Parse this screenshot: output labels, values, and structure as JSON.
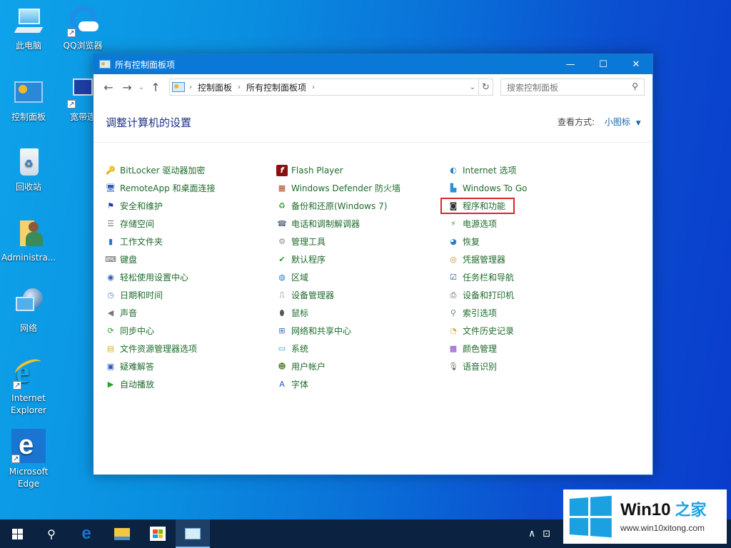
{
  "desktop": {
    "icons": [
      {
        "name": "this-pc",
        "label": "此电脑"
      },
      {
        "name": "qq-browser",
        "label": "QQ浏览器"
      },
      {
        "name": "control-panel",
        "label": "控制面板"
      },
      {
        "name": "broadband",
        "label": "宽带连"
      },
      {
        "name": "recycle-bin",
        "label": "回收站"
      },
      {
        "name": "administrator",
        "label": "Administra..."
      },
      {
        "name": "network",
        "label": "网络"
      },
      {
        "name": "internet-explorer",
        "label": "Internet Explorer"
      },
      {
        "name": "microsoft-edge",
        "label": "Microsoft Edge"
      }
    ]
  },
  "window": {
    "title": "所有控制面板项",
    "controls": {
      "minimize": "—",
      "maximize": "☐",
      "close": "✕"
    },
    "nav": {
      "back": "←",
      "forward": "→",
      "recent": "⌄",
      "up": "↑"
    },
    "breadcrumb": [
      "控制面板",
      "所有控制面板项"
    ],
    "search_placeholder": "搜索控制面板",
    "page_title": "调整计算机的设置",
    "view_by_label": "查看方式:",
    "view_by_value": "小图标",
    "highlighted_item": "程序和功能"
  },
  "items": {
    "col1": [
      {
        "label": "BitLocker 驱动器加密",
        "icon": "bitlocker-icon",
        "glyph": "🔑",
        "color": "#c8a030"
      },
      {
        "label": "RemoteApp 和桌面连接",
        "icon": "remoteapp-icon",
        "glyph": "🖥",
        "color": "#2a5cb8"
      },
      {
        "label": "安全和维护",
        "icon": "flag-icon",
        "glyph": "⚑",
        "color": "#1a3a9c"
      },
      {
        "label": "存储空间",
        "icon": "storage-icon",
        "glyph": "☰",
        "color": "#777777"
      },
      {
        "label": "工作文件夹",
        "icon": "work-folders-icon",
        "glyph": "▮",
        "color": "#2878c8"
      },
      {
        "label": "键盘",
        "icon": "keyboard-icon",
        "glyph": "⌨",
        "color": "#666666"
      },
      {
        "label": "轻松使用设置中心",
        "icon": "ease-of-access-icon",
        "glyph": "◉",
        "color": "#2a5cb8"
      },
      {
        "label": "日期和时间",
        "icon": "clock-icon",
        "glyph": "◷",
        "color": "#5a80b8"
      },
      {
        "label": "声音",
        "icon": "speaker-icon",
        "glyph": "◀",
        "color": "#777777"
      },
      {
        "label": "同步中心",
        "icon": "sync-icon",
        "glyph": "⟳",
        "color": "#2aa02a"
      },
      {
        "label": "文件资源管理器选项",
        "icon": "folder-options-icon",
        "glyph": "▤",
        "color": "#d8b040"
      },
      {
        "label": "疑难解答",
        "icon": "troubleshoot-icon",
        "glyph": "▣",
        "color": "#2a5cb8"
      },
      {
        "label": "自动播放",
        "icon": "autoplay-icon",
        "glyph": "▶",
        "color": "#2aa02a"
      }
    ],
    "col2": [
      {
        "label": "Flash Player",
        "icon": "flash-icon",
        "glyph": "f",
        "color": "#8a1010"
      },
      {
        "label": "Windows Defender 防火墙",
        "icon": "firewall-icon",
        "glyph": "▦",
        "color": "#b04020"
      },
      {
        "label": "备份和还原(Windows 7)",
        "icon": "backup-icon",
        "glyph": "♻",
        "color": "#3a9a3a"
      },
      {
        "label": "电话和调制解调器",
        "icon": "phone-icon",
        "glyph": "☎",
        "color": "#5a6a80"
      },
      {
        "label": "管理工具",
        "icon": "admin-tools-icon",
        "glyph": "⚙",
        "color": "#888888"
      },
      {
        "label": "默认程序",
        "icon": "default-programs-icon",
        "glyph": "✔",
        "color": "#2a9a2a"
      },
      {
        "label": "区域",
        "icon": "region-icon",
        "glyph": "◍",
        "color": "#2a80c8"
      },
      {
        "label": "设备管理器",
        "icon": "device-manager-icon",
        "glyph": "⎍",
        "color": "#555555"
      },
      {
        "label": "鼠标",
        "icon": "mouse-icon",
        "glyph": "⬮",
        "color": "#555555"
      },
      {
        "label": "网络和共享中心",
        "icon": "network-sharing-icon",
        "glyph": "⊞",
        "color": "#2a70b8"
      },
      {
        "label": "系统",
        "icon": "system-icon",
        "glyph": "▭",
        "color": "#2a90d8"
      },
      {
        "label": "用户帐户",
        "icon": "user-accounts-icon",
        "glyph": "☻",
        "color": "#6a8a4a"
      },
      {
        "label": "字体",
        "icon": "fonts-icon",
        "glyph": "A",
        "color": "#2a5cb8"
      }
    ],
    "col3": [
      {
        "label": "Internet 选项",
        "icon": "internet-options-icon",
        "glyph": "◐",
        "color": "#2a80c8"
      },
      {
        "label": "Windows To Go",
        "icon": "windows-to-go-icon",
        "glyph": "▙",
        "color": "#2a90d8"
      },
      {
        "label": "程序和功能",
        "icon": "programs-features-icon",
        "glyph": "◙",
        "color": "#333333"
      },
      {
        "label": "电源选项",
        "icon": "power-icon",
        "glyph": "⚡",
        "color": "#3a9a3a"
      },
      {
        "label": "恢复",
        "icon": "recovery-icon",
        "glyph": "◕",
        "color": "#2a80c8"
      },
      {
        "label": "凭据管理器",
        "icon": "credential-icon",
        "glyph": "◎",
        "color": "#c09030"
      },
      {
        "label": "任务栏和导航",
        "icon": "taskbar-icon",
        "glyph": "☑",
        "color": "#2a5cb8"
      },
      {
        "label": "设备和打印机",
        "icon": "printer-icon",
        "glyph": "⎙",
        "color": "#555555"
      },
      {
        "label": "索引选项",
        "icon": "indexing-icon",
        "glyph": "⚲",
        "color": "#6a7a8a"
      },
      {
        "label": "文件历史记录",
        "icon": "file-history-icon",
        "glyph": "◔",
        "color": "#d8b040"
      },
      {
        "label": "颜色管理",
        "icon": "color-management-icon",
        "glyph": "▩",
        "color": "#8a40c8"
      },
      {
        "label": "语音识别",
        "icon": "microphone-icon",
        "glyph": "🎙",
        "color": "#666666"
      }
    ]
  },
  "taskbar": {
    "start": "⊞",
    "search": "⚲",
    "apps": [
      "edge",
      "file-explorer",
      "store",
      "control-panel"
    ],
    "tray_chevron": "∧"
  },
  "watermark": {
    "brand": "Win10",
    "brand_cn": "之家",
    "url": "www.win10xitong.com"
  },
  "colors": {
    "titlebar": "#0a78d7",
    "link_green": "#1f6b2c",
    "heading_blue": "#1e3287",
    "highlight_red": "#d92626"
  }
}
